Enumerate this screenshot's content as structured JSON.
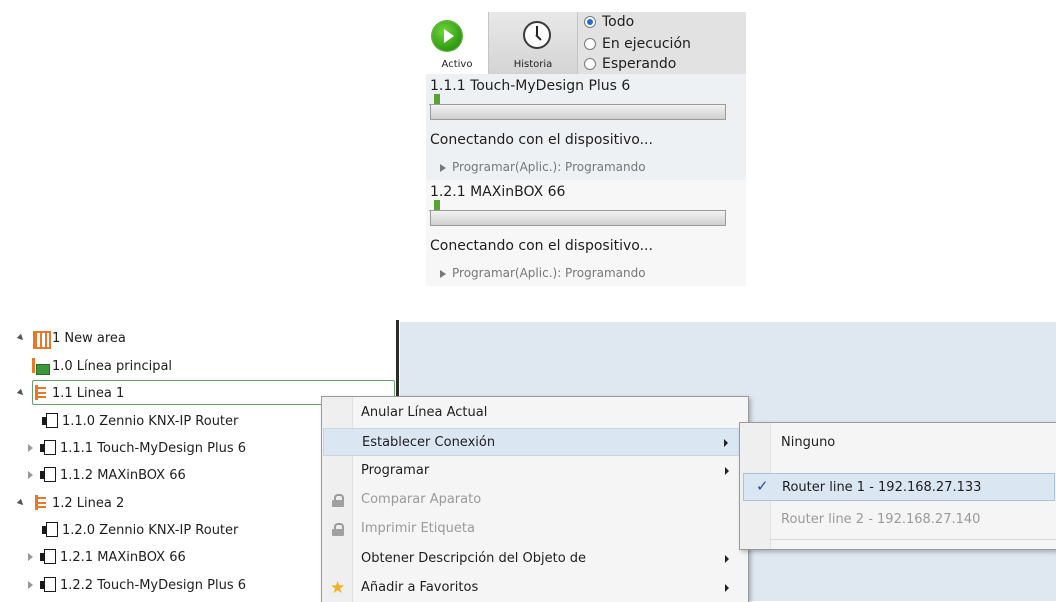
{
  "progress_panel": {
    "tools": {
      "active_label": "Activo",
      "history_label": "Historia"
    },
    "filters": {
      "all": "Todo",
      "running": "En ejecución",
      "waiting": "Esperando",
      "selected": "Todo"
    },
    "jobs": [
      {
        "title": "1.1.1 Touch-MyDesign Plus 6",
        "status": "Conectando con el dispositivo...",
        "substatus": "Programar(Aplic.): Programando"
      },
      {
        "title": "1.2.1 MAXinBOX 66",
        "status": "Conectando con el dispositivo...",
        "substatus": "Programar(Aplic.): Programando"
      }
    ]
  },
  "tree": {
    "items": [
      {
        "label": "1 New area"
      },
      {
        "label": "1.0 Línea principal"
      },
      {
        "label": "1.1 Linea 1"
      },
      {
        "label": "1.1.0  Zennio KNX-IP Router"
      },
      {
        "label": "1.1.1  Touch-MyDesign Plus 6"
      },
      {
        "label": "1.1.2  MAXinBOX 66"
      },
      {
        "label": "1.2 Linea 2"
      },
      {
        "label": "1.2.0  Zennio KNX-IP Router"
      },
      {
        "label": "1.2.1  MAXinBOX 66"
      },
      {
        "label": "1.2.2  Touch-MyDesign Plus 6"
      }
    ]
  },
  "context_menu": {
    "items": [
      {
        "label": "Anular Línea Actual"
      },
      {
        "label": "Establecer Conexión"
      },
      {
        "label": "Programar"
      },
      {
        "label": "Comparar Aparato"
      },
      {
        "label": "Imprimir Etiqueta"
      },
      {
        "label": "Obtener Descripción del Objeto de"
      },
      {
        "label": "Añadir a Favoritos"
      }
    ]
  },
  "submenu": {
    "items": [
      {
        "label": "Ninguno"
      },
      {
        "label": "Router line 1 - 192.168.27.133",
        "checked": true
      },
      {
        "label": "Router line 2 - 192.168.27.140"
      }
    ]
  },
  "colors": {
    "accent_green": "#3f8f20",
    "tree_orange": "#e6792a",
    "menu_highlight": "#dbe6f3",
    "right_pane_bg": "#dfe7f0"
  }
}
